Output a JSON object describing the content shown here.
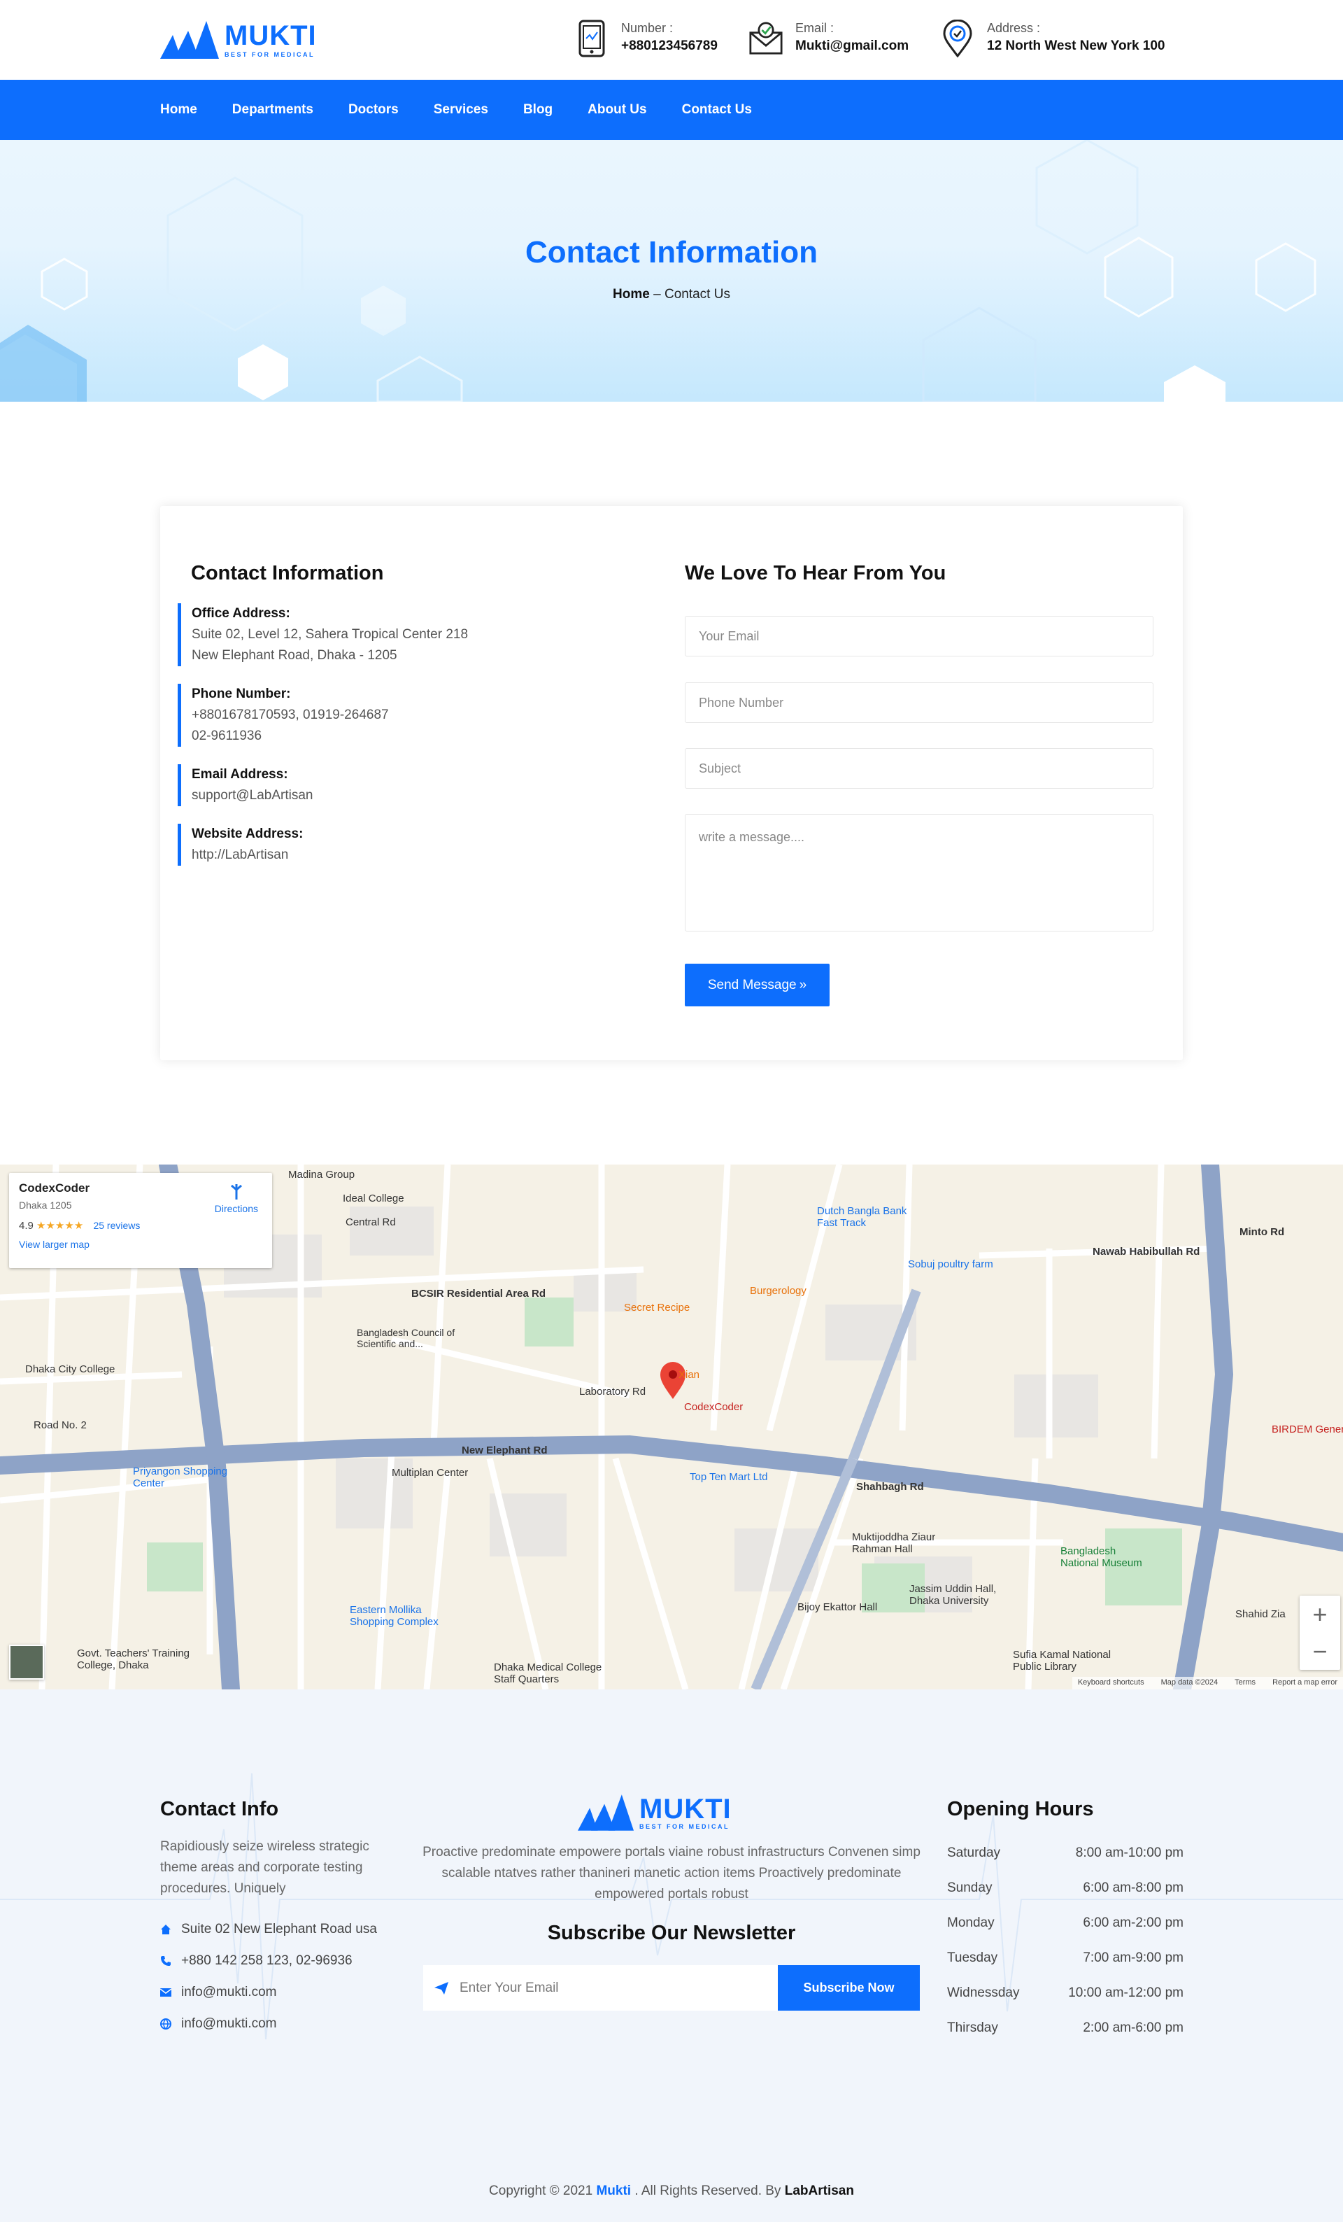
{
  "brand": {
    "name": "MUKTI",
    "tagline": "BEST FOR MEDICAL",
    "color": "#0d6efd"
  },
  "header": {
    "number": {
      "label": "Number :",
      "value": "+880123456789",
      "icon": "phone-icon"
    },
    "email": {
      "label": "Email :",
      "value": "Mukti@gmail.com",
      "icon": "envelope-icon"
    },
    "address": {
      "label": "Address :",
      "value": "12 North West New York 100",
      "icon": "location-pin-icon"
    }
  },
  "nav": {
    "items": [
      "Home",
      "Departments",
      "Doctors",
      "Services",
      "Blog",
      "About Us",
      "Contact Us"
    ]
  },
  "banner": {
    "title": "Contact Information",
    "crumb_home": "Home",
    "crumb_sep": "–",
    "crumb_current": "Contact Us"
  },
  "contact": {
    "title": "Contact Information",
    "office": {
      "label": "Office Address:",
      "line1": "Suite 02, Level 12, Sahera Tropical Center 218",
      "line2": "New Elephant Road, Dhaka - 1205"
    },
    "phone": {
      "label": "Phone Number:",
      "line1": "+8801678170593, 01919-264687",
      "line2": "02-9611936"
    },
    "email": {
      "label": "Email Address:",
      "line1": "support@LabArtisan"
    },
    "website": {
      "label": "Website Address:",
      "line1": "http://LabArtisan"
    }
  },
  "form": {
    "title": "We Love To Hear From You",
    "email_placeholder": "Your Email",
    "phone_placeholder": "Phone Number",
    "subject_placeholder": "Subject",
    "message_placeholder": "write a message....",
    "send_label": "Send Message",
    "send_icon": "»"
  },
  "map": {
    "place": "CodexCoder",
    "area": "Dhaka 1205",
    "rating": "4.9",
    "stars": "★★★★★",
    "reviews": "25 reviews",
    "larger": "View larger map",
    "directions": "Directions",
    "labels": [
      "Madina Group",
      "Ideal College",
      "Central Rd",
      "BCSIR Residential Area Rd",
      "Bangladesh Council of Scientific and...",
      "Dhaka City College",
      "Road No. 2",
      "Secret Recipe",
      "Burgerology",
      "Xian",
      "Laboratory Rd",
      "CodexCoder",
      "New Elephant Rd",
      "Top Ten Mart Ltd",
      "Shahbagh Rd",
      "Dutch Bangla Bank Fast Track",
      "Sobuj poultry farm",
      "Nawab Habibullah Rd",
      "Minto Rd",
      "Multiplan Center",
      "Eastern Mollika Shopping Complex",
      "Dhaka Medical College Staff Quarters",
      "Muktijoddha Ziaur Rahman Hall",
      "Bangladesh National Museum",
      "Jassim Uddin Hall, Dhaka University",
      "Bijoy Ekattor Hall",
      "Sufia Kamal National Public Library",
      "BIRDEM General Hosp",
      "Shahid Zia",
      "Priyangon Shopping Center",
      "Govt. Teachers' Training College, Dhaka"
    ],
    "footer": [
      "Keyboard shortcuts",
      "Map data ©2024",
      "Terms",
      "Report a map error"
    ]
  },
  "footer": {
    "info_title": "Contact Info",
    "info_text": "Rapidiously seize wireless strategic theme areas and corporate testing procedures. Uniquely",
    "address": "Suite 02 New Elephant Road usa",
    "phone": "+880 142 258 123, 02-96936",
    "email1": "info@mukti.com",
    "email2": "info@mukti.com",
    "about": "Proactive predominate empowere portals viaine robust infrastructurs Convenen simp scalable ntatves rather thanineri manetic action items Proactively predominate empowered portals robust",
    "news_title": "Subscribe Our Newsletter",
    "news_placeholder": "Enter Your Email",
    "news_button": "Subscribe Now",
    "hours_title": "Opening Hours",
    "hours": [
      {
        "day": "Saturday",
        "time": "8:00 am-10:00 pm"
      },
      {
        "day": "Sunday",
        "time": "6:00 am-8:00 pm"
      },
      {
        "day": "Monday",
        "time": "6:00 am-2:00 pm"
      },
      {
        "day": "Tuesday",
        "time": "7:00 am-9:00 pm"
      },
      {
        "day": "Widnessday",
        "time": "10:00 am-12:00 pm"
      },
      {
        "day": "Thirsday",
        "time": "2:00 am-6:00 pm"
      }
    ],
    "copy_prefix": "Copyright © 2021",
    "copy_brand": "Mukti",
    "copy_mid": ". All Rights Reserved. By",
    "copy_author": "LabArtisan"
  }
}
